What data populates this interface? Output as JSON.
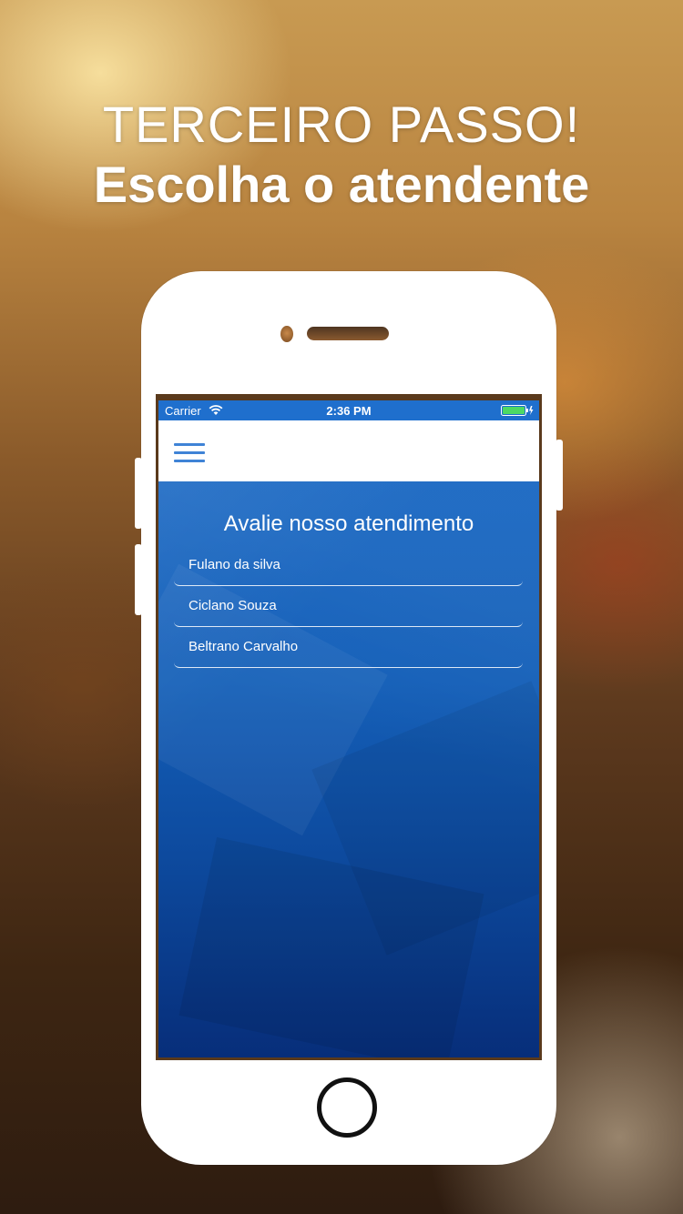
{
  "headline": {
    "line1": "TERCEIRO PASSO!",
    "line2": "Escolha o atendente"
  },
  "status_bar": {
    "carrier": "Carrier",
    "time": "2:36 PM",
    "wifi_icon": "wifi-icon",
    "battery_icon": "battery-charging-icon",
    "color": "#1f6fcd"
  },
  "nav_bar": {
    "menu_icon": "hamburger-menu-icon"
  },
  "main": {
    "title": "Avalie nosso atendimento",
    "attendants": [
      {
        "name": "Fulano da silva"
      },
      {
        "name": "Ciclano Souza"
      },
      {
        "name": "Beltrano Carvalho"
      }
    ]
  },
  "colors": {
    "accent": "#3f83d6",
    "content_background": "#145fb8"
  }
}
